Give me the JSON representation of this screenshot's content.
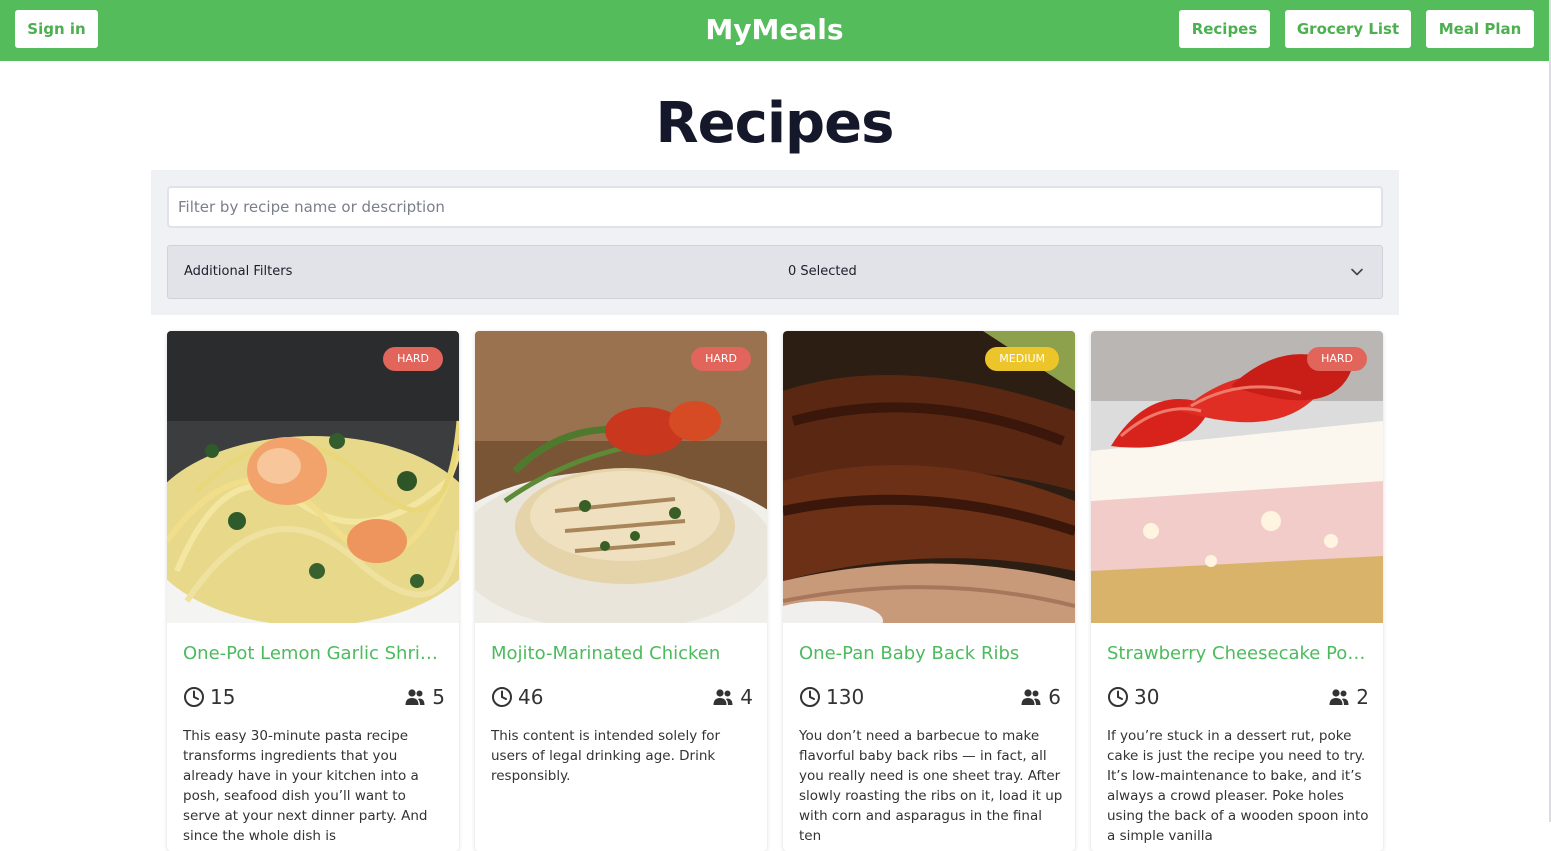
{
  "nav": {
    "sign_in": "Sign in",
    "brand": "MyMeals",
    "links": [
      "Recipes",
      "Grocery List",
      "Meal Plan"
    ]
  },
  "page": {
    "title": "Recipes"
  },
  "filters": {
    "search_placeholder": "Filter by recipe name or description",
    "search_value": "",
    "additional_label": "Additional Filters",
    "selected_text": "0 Selected"
  },
  "colors": {
    "brand": "#54bc5b",
    "hard": "#e2655b",
    "medium": "#ecc52a"
  },
  "recipes": [
    {
      "title": "One-Pot Lemon Garlic Shrimp Pasta",
      "difficulty": "HARD",
      "time": "15",
      "servings": "5",
      "description": "This easy 30-minute pasta recipe transforms ingredients that you already have in your kitchen into a posh, seafood dish you’ll want to serve at your next dinner party. And since the whole dish is",
      "photo": "shrimp-pasta"
    },
    {
      "title": "Mojito-Marinated Chicken",
      "difficulty": "HARD",
      "time": "46",
      "servings": "4",
      "description": "This content is intended solely for users of legal drinking age. Drink responsibly.",
      "photo": "grilled-chicken"
    },
    {
      "title": "One-Pan Baby Back Ribs",
      "difficulty": "MEDIUM",
      "time": "130",
      "servings": "6",
      "description": "You don’t need a barbecue to make flavorful baby back ribs — in fact, all you really need is one sheet tray. After slowly roasting the ribs on it, load it up with corn and asparagus in the final ten",
      "photo": "baby-back-ribs"
    },
    {
      "title": "Strawberry Cheesecake Poke Cake",
      "difficulty": "HARD",
      "time": "30",
      "servings": "2",
      "description": "If you’re stuck in a dessert rut, poke cake is just the recipe you need to try. It’s low-maintenance to bake, and it’s always a crowd pleaser. Poke holes using the back of a wooden spoon into a simple vanilla",
      "photo": "strawberry-poke-cake"
    }
  ]
}
